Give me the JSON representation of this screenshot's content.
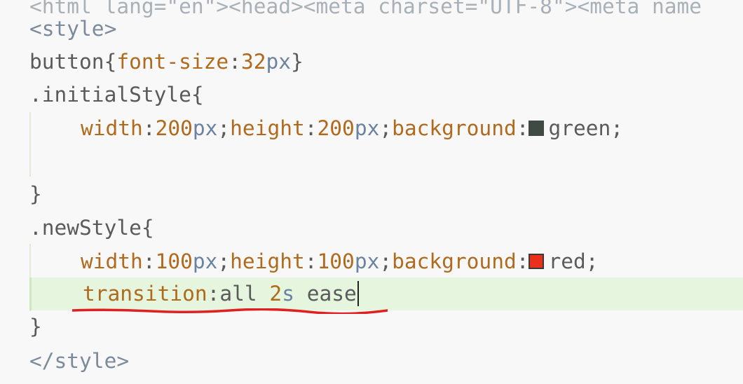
{
  "editor": {
    "top_partial_text": "<html lang=\"en\"><head><meta charset=\"UTF-8\"><meta name",
    "lines": {
      "style_open": "<style>",
      "button_selector": "button",
      "button_open_brace": "{",
      "button_prop": "font-size",
      "button_colon": ":",
      "button_num": "32",
      "button_unit": "px",
      "button_close_brace": "}",
      "initial_selector": ".initialStyle",
      "initial_open_brace": "{",
      "initial_width_prop": "width",
      "initial_width_num": "200",
      "initial_height_prop": "height",
      "initial_height_num": "200",
      "initial_bg_prop": "background",
      "initial_bg_val": "green",
      "initial_close_brace": "}",
      "new_selector": ".newStyle",
      "new_open_brace": "{",
      "new_width_prop": "width",
      "new_width_num": "100",
      "new_height_prop": "height",
      "new_height_num": "100",
      "new_bg_prop": "background",
      "new_bg_val": "red",
      "transition_prop": "transition",
      "transition_val_1": "all ",
      "transition_num": "2",
      "transition_unit": "s",
      "transition_val_2": " ease",
      "new_close_brace": "}",
      "style_close": "</style>",
      "px": "px",
      "colon": ":",
      "semicolon": ";"
    },
    "colors": {
      "green_swatch": "#3f4a44",
      "red_swatch": "#e8301c",
      "highlight_line": "#e6f5dd",
      "squiggle": "#e02020"
    }
  }
}
